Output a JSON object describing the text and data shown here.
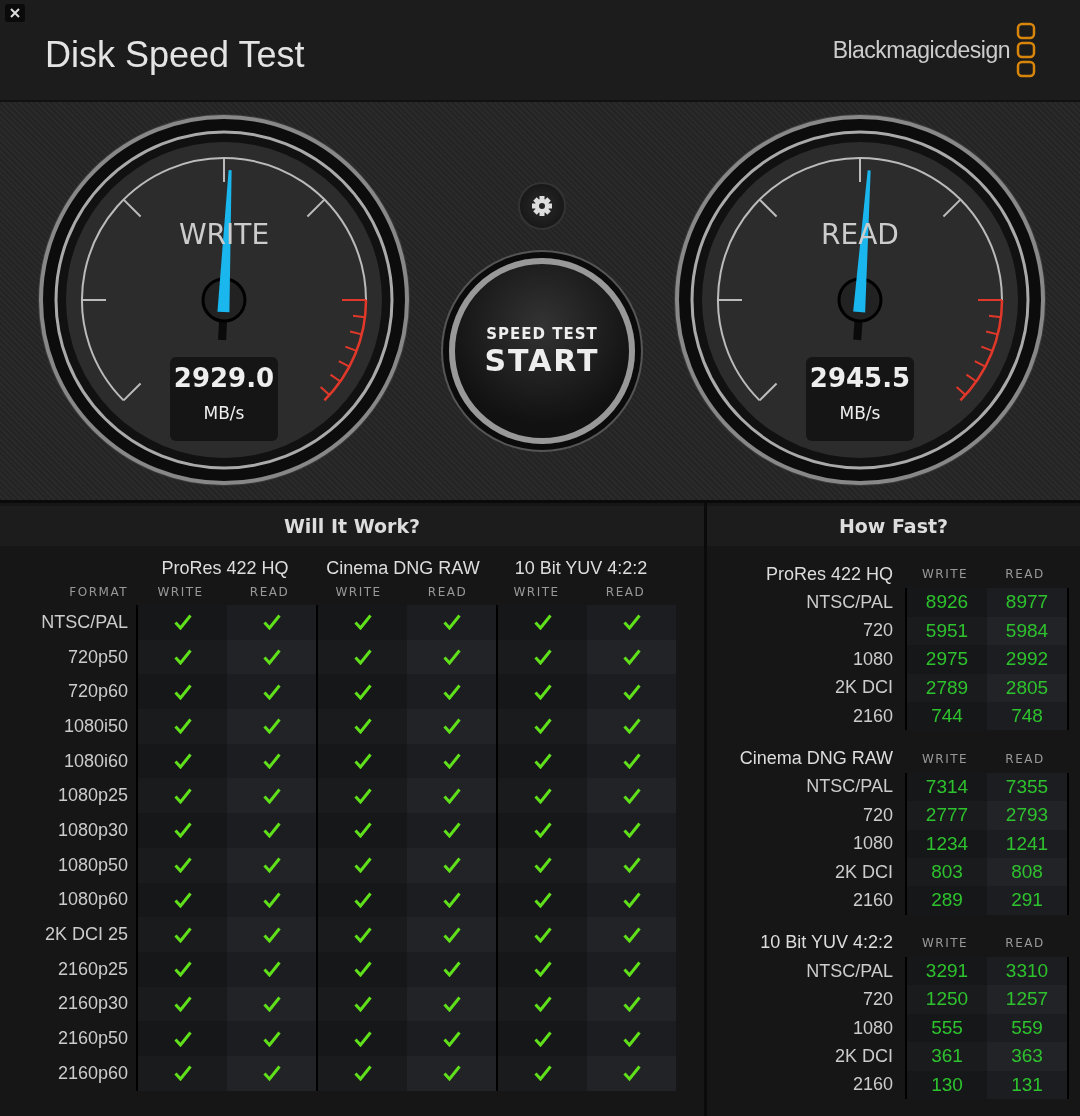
{
  "window": {
    "title": "Disk Speed Test",
    "brand": "Blackmagicdesign"
  },
  "gauges": [
    {
      "label": "WRITE",
      "value": "2929.0",
      "unit": "MB/s",
      "level": 0.51
    },
    {
      "label": "READ",
      "value": "2945.5",
      "unit": "MB/s",
      "level": 0.515
    }
  ],
  "start_button": {
    "caption": "SPEED TEST",
    "label": "START"
  },
  "will_it_work": {
    "title": "Will It Work?",
    "format_label": "FORMAT",
    "codecs": [
      "ProRes 422 HQ",
      "Cinema DNG RAW",
      "10 Bit YUV 4:2:2"
    ],
    "sub_columns": [
      "WRITE",
      "READ",
      "WRITE",
      "READ",
      "WRITE",
      "READ"
    ],
    "rows": [
      {
        "format": "NTSC/PAL",
        "cells": [
          true,
          true,
          true,
          true,
          true,
          true
        ]
      },
      {
        "format": "720p50",
        "cells": [
          true,
          true,
          true,
          true,
          true,
          true
        ]
      },
      {
        "format": "720p60",
        "cells": [
          true,
          true,
          true,
          true,
          true,
          true
        ]
      },
      {
        "format": "1080i50",
        "cells": [
          true,
          true,
          true,
          true,
          true,
          true
        ]
      },
      {
        "format": "1080i60",
        "cells": [
          true,
          true,
          true,
          true,
          true,
          true
        ]
      },
      {
        "format": "1080p25",
        "cells": [
          true,
          true,
          true,
          true,
          true,
          true
        ]
      },
      {
        "format": "1080p30",
        "cells": [
          true,
          true,
          true,
          true,
          true,
          true
        ]
      },
      {
        "format": "1080p50",
        "cells": [
          true,
          true,
          true,
          true,
          true,
          true
        ]
      },
      {
        "format": "1080p60",
        "cells": [
          true,
          true,
          true,
          true,
          true,
          true
        ]
      },
      {
        "format": "2K DCI 25",
        "cells": [
          true,
          true,
          true,
          true,
          true,
          true
        ]
      },
      {
        "format": "2160p25",
        "cells": [
          true,
          true,
          true,
          true,
          true,
          true
        ]
      },
      {
        "format": "2160p30",
        "cells": [
          true,
          true,
          true,
          true,
          true,
          true
        ]
      },
      {
        "format": "2160p50",
        "cells": [
          true,
          true,
          true,
          true,
          true,
          true
        ]
      },
      {
        "format": "2160p60",
        "cells": [
          true,
          true,
          true,
          true,
          true,
          true
        ]
      }
    ]
  },
  "how_fast": {
    "title": "How Fast?",
    "groups": [
      {
        "codec": "ProRes 422 HQ",
        "write_label": "WRITE",
        "read_label": "READ",
        "rows": [
          {
            "format": "NTSC/PAL",
            "write": "8926",
            "read": "8977"
          },
          {
            "format": "720",
            "write": "5951",
            "read": "5984"
          },
          {
            "format": "1080",
            "write": "2975",
            "read": "2992"
          },
          {
            "format": "2K DCI",
            "write": "2789",
            "read": "2805"
          },
          {
            "format": "2160",
            "write": "744",
            "read": "748"
          }
        ]
      },
      {
        "codec": "Cinema DNG RAW",
        "write_label": "WRITE",
        "read_label": "READ",
        "rows": [
          {
            "format": "NTSC/PAL",
            "write": "7314",
            "read": "7355"
          },
          {
            "format": "720",
            "write": "2777",
            "read": "2793"
          },
          {
            "format": "1080",
            "write": "1234",
            "read": "1241"
          },
          {
            "format": "2K DCI",
            "write": "803",
            "read": "808"
          },
          {
            "format": "2160",
            "write": "289",
            "read": "291"
          }
        ]
      },
      {
        "codec": "10 Bit YUV 4:2:2",
        "write_label": "WRITE",
        "read_label": "READ",
        "rows": [
          {
            "format": "NTSC/PAL",
            "write": "3291",
            "read": "3310"
          },
          {
            "format": "720",
            "write": "1250",
            "read": "1257"
          },
          {
            "format": "1080",
            "write": "555",
            "read": "559"
          },
          {
            "format": "2K DCI",
            "write": "361",
            "read": "363"
          },
          {
            "format": "2160",
            "write": "130",
            "read": "131"
          }
        ]
      }
    ]
  }
}
